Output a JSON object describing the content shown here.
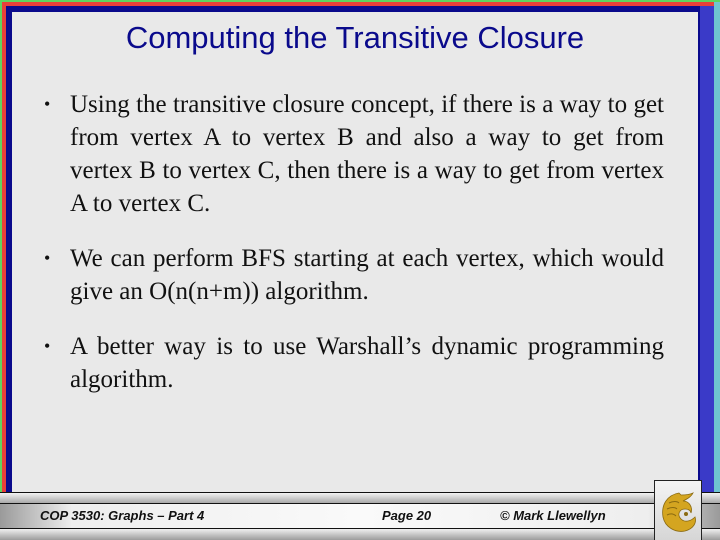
{
  "slide": {
    "title": "Computing the Transitive Closure",
    "bullets": [
      {
        "marker": "•",
        "text": "Using the transitive closure concept, if there is a way to get from vertex A to vertex B and also a way to get from vertex B to vertex C, then there is a way to get from vertex A to vertex C."
      },
      {
        "marker": "•",
        "text": "We can perform BFS starting at each vertex, which would give an O(n(n+m)) algorithm."
      },
      {
        "marker": "•",
        "text": "A better way is to use Warshall’s dynamic programming algorithm."
      }
    ]
  },
  "footer": {
    "course": "COP 3530: Graphs – Part 4",
    "page": "Page 20",
    "copyright": "© Mark Llewellyn",
    "logo_icon": "pegasus-logo-icon"
  },
  "colors": {
    "title": "#0a0a8c",
    "frame_green": "#5fd35f",
    "frame_red": "#e8403a",
    "frame_navy": "#0a0a8c",
    "frame_blue": "#3a3ac8",
    "logo_gold": "#d4a520"
  }
}
